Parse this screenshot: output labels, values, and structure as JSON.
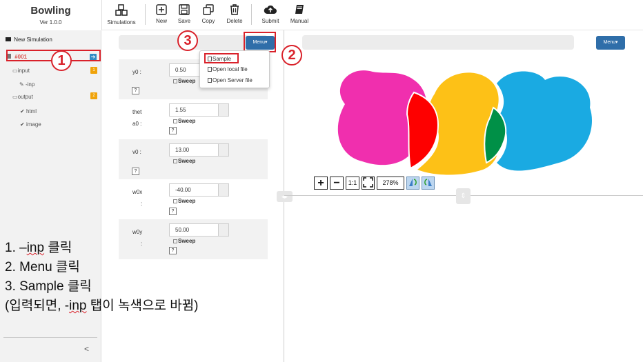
{
  "app": {
    "name": "Bowling",
    "version": "Ver 1.0.0"
  },
  "toolbar": {
    "simulations": "Simulations",
    "new": "New",
    "save": "Save",
    "copy": "Copy",
    "delete": "Delete",
    "submit": "Submit",
    "manual": "Manual"
  },
  "sidebar": {
    "new_simulation": "New Simulation",
    "sim_id": "#001",
    "input": "input",
    "input_badge": "1",
    "inp": "-inp",
    "output": "output",
    "output_badge": "2",
    "html": "html",
    "image": "image",
    "collapse": "<"
  },
  "panel": {
    "menu_label": "Menu▾",
    "right_menu_label": "Menu▾"
  },
  "params": [
    {
      "label": "y0 :",
      "value": "0.50",
      "sweep": "Sweep",
      "q": "?"
    },
    {
      "label": "thet",
      "label2": "a0 :",
      "value": "1.55",
      "sweep": "Sweep",
      "q": "?"
    },
    {
      "label": "v0 :",
      "value": "13.00",
      "sweep": "Sweep",
      "q": "?"
    },
    {
      "label": "w0x",
      "label2": ":",
      "value": "-40.00",
      "sweep": "Sweep",
      "q": "?"
    },
    {
      "label": "w0y",
      "label2": ":",
      "value": "50.00",
      "sweep": "Sweep",
      "q": "?"
    }
  ],
  "dropdown": {
    "sample": "Sample",
    "open_local": "Open local file",
    "open_server": "Open Server file"
  },
  "zoom": {
    "plus": "+",
    "minus": "−",
    "one_to_one": "1:1",
    "level": "278%"
  },
  "annotations": {
    "one": "1",
    "two": "2",
    "three": "3"
  },
  "instructions": {
    "line1a": "1. –",
    "line1b": "inp",
    "line1c": " 클릭",
    "line2": "2. Menu 클릭",
    "line3": "3. Sample 클릭",
    "line4a": "(입력되면, -",
    "line4b": "inp",
    "line4c": " 탭이 녹색으로 바뀜)"
  },
  "colors": {
    "menu_blue": "#2f6ea9",
    "annotation_red": "#d9212a",
    "magenta": "#f02fae",
    "yellow": "#fdc117",
    "cyan": "#1aaae2",
    "red": "#fe0000",
    "green": "#009047"
  }
}
